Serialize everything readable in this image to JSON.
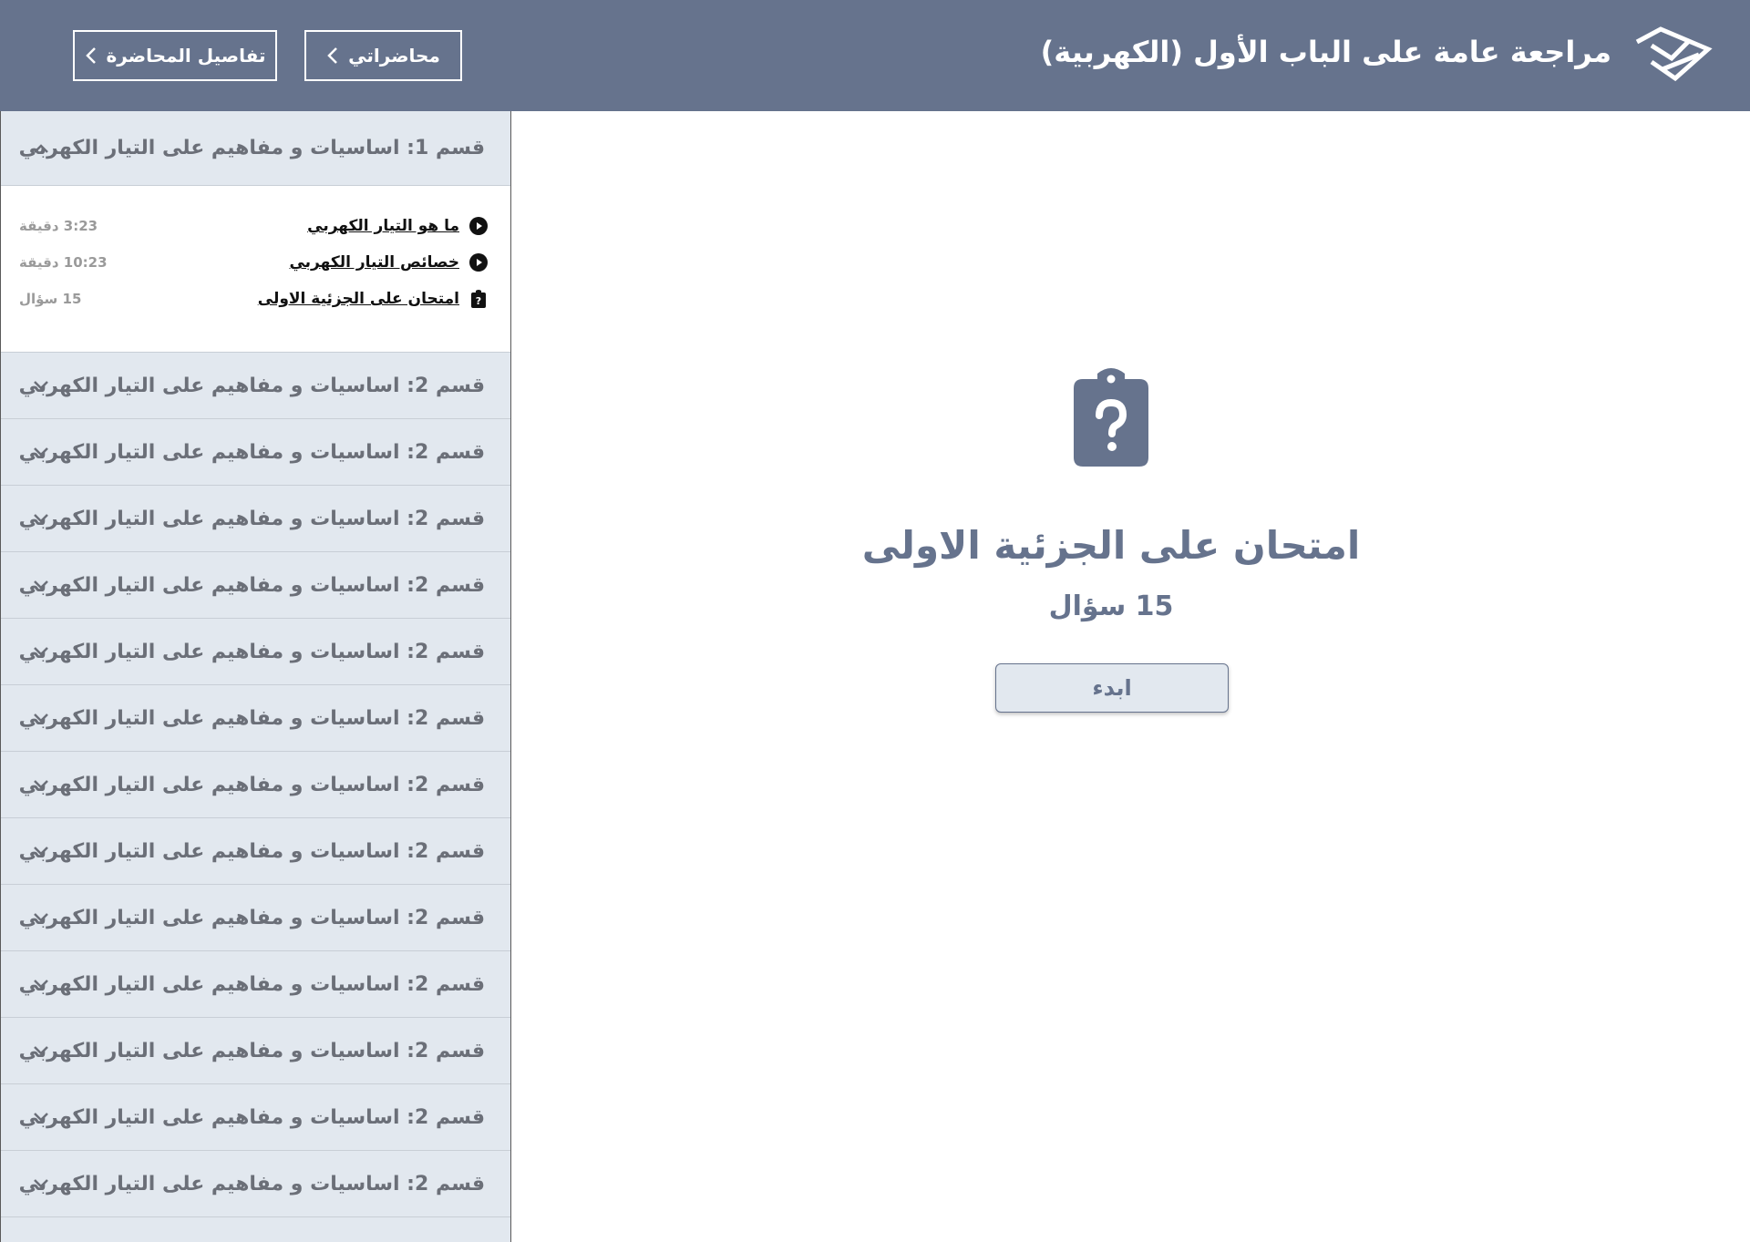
{
  "header": {
    "title": "مراجعة عامة على الباب الأول (الكهربية)",
    "lectures_button": "محاضراتي",
    "details_button": "تفاصيل المحاضرة",
    "logo_icon": "brand-logo-icon"
  },
  "sidebar": {
    "active_section": {
      "label": "قسم 1: اساسيات و مفاهيم على التيار الكهربي",
      "lessons": [
        {
          "title": "ما هو التيار الكهربي",
          "meta": "3:23 دقيقة",
          "icon": "play-circle-icon"
        },
        {
          "title": "خصائص التيار الكهربي",
          "meta": "10:23 دقيقة",
          "icon": "play-circle-icon"
        },
        {
          "title": "امتحان على الجزئية الاولى",
          "meta": "15 سؤال",
          "icon": "quiz-clipboard-icon"
        }
      ]
    },
    "sections": [
      {
        "label": "قسم 2: اساسيات و مفاهيم على التيار الكهربي"
      },
      {
        "label": "قسم 2: اساسيات و مفاهيم على التيار الكهربي"
      },
      {
        "label": "قسم 2: اساسيات و مفاهيم على التيار الكهربي"
      },
      {
        "label": "قسم 2: اساسيات و مفاهيم على التيار الكهربي"
      },
      {
        "label": "قسم 2: اساسيات و مفاهيم على التيار الكهربي"
      },
      {
        "label": "قسم 2: اساسيات و مفاهيم على التيار الكهربي"
      },
      {
        "label": "قسم 2: اساسيات و مفاهيم على التيار الكهربي"
      },
      {
        "label": "قسم 2: اساسيات و مفاهيم على التيار الكهربي"
      },
      {
        "label": "قسم 2: اساسيات و مفاهيم على التيار الكهربي"
      },
      {
        "label": "قسم 2: اساسيات و مفاهيم على التيار الكهربي"
      },
      {
        "label": "قسم 2: اساسيات و مفاهيم على التيار الكهربي"
      },
      {
        "label": "قسم 2: اساسيات و مفاهيم على التيار الكهربي"
      },
      {
        "label": "قسم 2: اساسيات و مفاهيم على التيار الكهربي"
      }
    ]
  },
  "main": {
    "exam_title": "امتحان على الجزئية الاولى",
    "exam_count": "15 سؤال",
    "start_button": "ابدء",
    "icon": "quiz-clipboard-icon"
  },
  "colors": {
    "primary": "#66738d",
    "panel": "#e2e8ef",
    "section_text": "#6b6f78",
    "meta_text": "#9a9a9a"
  }
}
